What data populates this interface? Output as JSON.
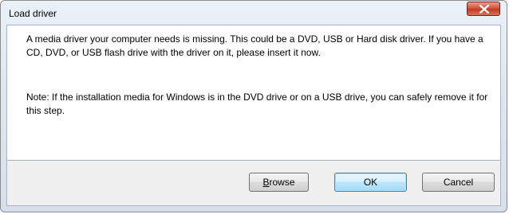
{
  "window": {
    "title": "Load driver"
  },
  "message": {
    "paragraph1": "A media driver your computer needs is missing. This could be a DVD, USB or Hard disk driver. If you have a CD, DVD, or USB flash drive with the driver on it, please insert it now.",
    "paragraph2": "Note: If the installation media for Windows is in the DVD drive or on a USB drive, you can safely remove it for this step."
  },
  "buttons": {
    "browse_mnemonic": "B",
    "browse_rest": "rowse",
    "ok_label": "OK",
    "cancel_label": "Cancel"
  },
  "icons": {
    "close": "close-icon"
  },
  "colors": {
    "close_button": "#c03a22",
    "default_button_border": "#3c7fb1"
  }
}
